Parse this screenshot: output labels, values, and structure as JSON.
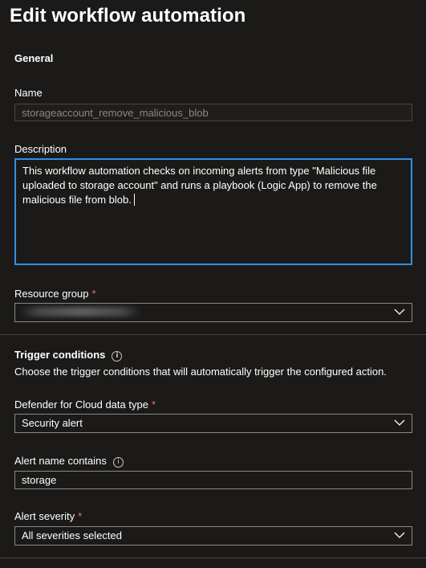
{
  "page": {
    "title": "Edit workflow automation"
  },
  "general": {
    "heading": "General",
    "name_label": "Name",
    "name_value": "storageaccount_remove_malicious_blob",
    "description_label": "Description",
    "description_value": "This workflow automation checks on incoming alerts from type \"Malicious file uploaded to storage account\" and runs a playbook (Logic App) to remove the malicious file from blob.",
    "resource_group_label": "Resource group",
    "required_mark": "*"
  },
  "trigger": {
    "heading": "Trigger conditions",
    "description": "Choose the trigger conditions that will automatically trigger the configured action.",
    "data_type_label": "Defender for Cloud data type",
    "data_type_value": "Security alert",
    "alert_name_label": "Alert name contains",
    "alert_name_value": "storage",
    "severity_label": "Alert severity",
    "severity_value": "All severities selected",
    "required_mark": "*"
  },
  "icons": {
    "info": "info-icon",
    "chevron": "chevron-down-icon"
  },
  "colors": {
    "background": "#1b1a19",
    "focus_border": "#2f8fe6",
    "required": "#f1707b",
    "input_border": "#8a8886"
  }
}
